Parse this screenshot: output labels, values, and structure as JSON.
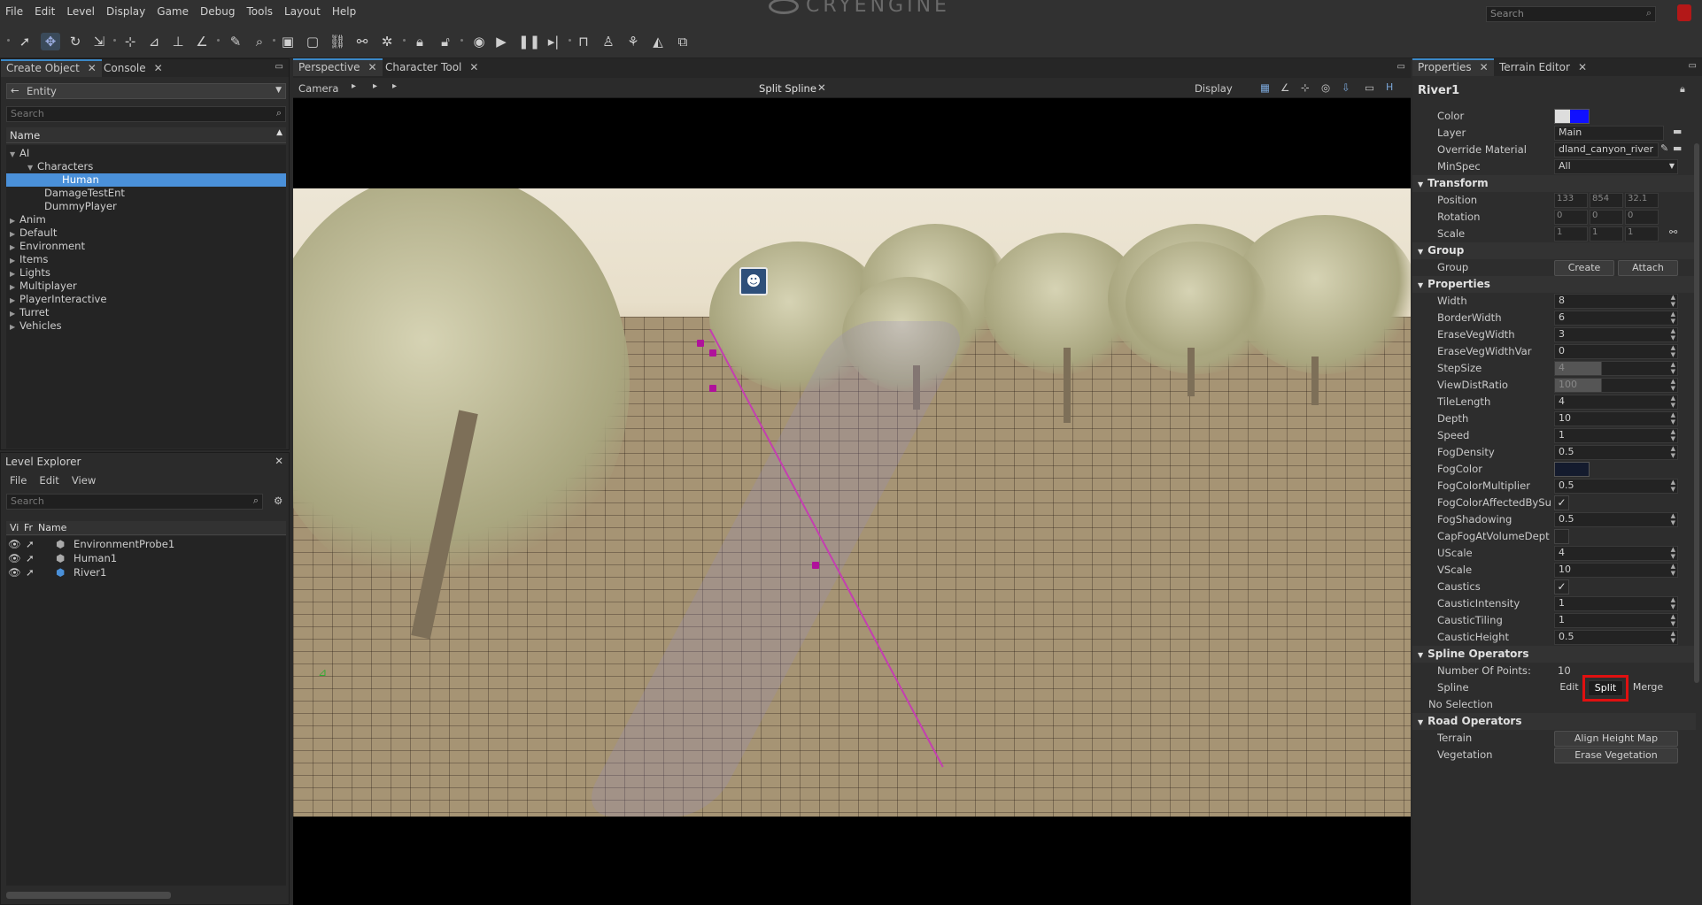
{
  "menu": [
    "File",
    "Edit",
    "Level",
    "Display",
    "Game",
    "Debug",
    "Tools",
    "Layout",
    "Help"
  ],
  "logo_text": "CRYENGINE",
  "top_search": {
    "placeholder": "Search"
  },
  "toolbar_icons": [
    "select-icon",
    "move-icon",
    "rotate-icon",
    "scale-icon",
    "snap-grid-icon",
    "snap-terrain-icon",
    "align-icon",
    "snap-angle-icon",
    "paint-icon",
    "zoom-icon",
    "group-icon",
    "ungroup-icon",
    "link-icon",
    "unlink-icon",
    "physics-icon",
    "lock-icon",
    "unlock-icon",
    "game-mode-icon",
    "play-icon",
    "pause-icon",
    "step-icon",
    "frame-icon",
    "character-icon",
    "vegetation-icon",
    "terrain-icon",
    "flowgraph-icon"
  ],
  "create_object": {
    "tabs": [
      "Create Object",
      "Console"
    ],
    "category": "Entity",
    "search_placeholder": "Search",
    "column": "Name",
    "tree": [
      {
        "label": "AI",
        "level": 0,
        "expanded": true
      },
      {
        "label": "Characters",
        "level": 1,
        "expanded": true
      },
      {
        "label": "Human",
        "level": 2,
        "selected": true
      },
      {
        "label": "DamageTestEnt",
        "level": 1
      },
      {
        "label": "DummyPlayer",
        "level": 1
      },
      {
        "label": "Anim",
        "level": 0
      },
      {
        "label": "Default",
        "level": 0
      },
      {
        "label": "Environment",
        "level": 0
      },
      {
        "label": "Items",
        "level": 0
      },
      {
        "label": "Lights",
        "level": 0
      },
      {
        "label": "Multiplayer",
        "level": 0
      },
      {
        "label": "PlayerInteractive",
        "level": 0
      },
      {
        "label": "Turret",
        "level": 0
      },
      {
        "label": "Vehicles",
        "level": 0
      }
    ]
  },
  "level_explorer": {
    "title": "Level Explorer",
    "menu": [
      "File",
      "Edit",
      "View"
    ],
    "search_placeholder": "Search",
    "columns": [
      "Vi",
      "Fr",
      "Name"
    ],
    "rows": [
      "EnvironmentProbe1",
      "Human1",
      "River1"
    ]
  },
  "viewport": {
    "tabs": [
      "Perspective",
      "Character Tool"
    ],
    "camera_label": "Camera",
    "mode_label": "Split Spline",
    "display_label": "Display"
  },
  "properties": {
    "tabs": [
      "Properties",
      "Terrain Editor"
    ],
    "object_name": "River1",
    "general": [
      {
        "label": "Color",
        "type": "color"
      },
      {
        "label": "Layer",
        "value": "Main"
      },
      {
        "label": "Override Material",
        "value": "dland_canyon_river"
      },
      {
        "label": "MinSpec",
        "value": "All"
      }
    ],
    "transform_title": "Transform",
    "transform": [
      {
        "label": "Position",
        "values": [
          "133",
          "854",
          "32.1"
        ]
      },
      {
        "label": "Rotation",
        "values": [
          "0",
          "0",
          "0"
        ]
      },
      {
        "label": "Scale",
        "values": [
          "1",
          "1",
          "1"
        ]
      }
    ],
    "group_title": "Group",
    "group_label": "Group",
    "group_buttons": [
      "Create",
      "Attach"
    ],
    "props_title": "Properties",
    "props": [
      {
        "label": "Width",
        "value": "8"
      },
      {
        "label": "BorderWidth",
        "value": "6"
      },
      {
        "label": "EraseVegWidth",
        "value": "3"
      },
      {
        "label": "EraseVegWidthVar",
        "value": "0"
      },
      {
        "label": "StepSize",
        "value": "4"
      },
      {
        "label": "ViewDistRatio",
        "value": "100"
      },
      {
        "label": "TileLength",
        "value": "4"
      },
      {
        "label": "Depth",
        "value": "10"
      },
      {
        "label": "Speed",
        "value": "1"
      },
      {
        "label": "FogDensity",
        "value": "0.5"
      },
      {
        "label": "FogColor",
        "value": ""
      },
      {
        "label": "FogColorMultiplier",
        "value": "0.5"
      },
      {
        "label": "FogColorAffectedBySu",
        "value": "checked"
      },
      {
        "label": "FogShadowing",
        "value": "0.5"
      },
      {
        "label": "CapFogAtVolumeDept",
        "value": "unchecked"
      },
      {
        "label": "UScale",
        "value": "4"
      },
      {
        "label": "VScale",
        "value": "10"
      },
      {
        "label": "Caustics",
        "value": "checked"
      },
      {
        "label": "CausticIntensity",
        "value": "1"
      },
      {
        "label": "CausticTiling",
        "value": "1"
      },
      {
        "label": "CausticHeight",
        "value": "0.5"
      }
    ],
    "spline_title": "Spline Operators",
    "num_points_label": "Number Of Points:",
    "num_points": "10",
    "spline_label": "Spline",
    "spline_buttons": [
      "Edit",
      "Split",
      "Merge"
    ],
    "no_selection": "No Selection",
    "road_title": "Road Operators",
    "terrain_label": "Terrain",
    "terrain_button": "Align Height Map",
    "veg_label": "Vegetation",
    "veg_button": "Erase Vegetation"
  },
  "colors": {
    "accent": "#3c89c7",
    "selection": "#4a90d9",
    "highlight": "#e01010",
    "spline": "#b0129b"
  }
}
